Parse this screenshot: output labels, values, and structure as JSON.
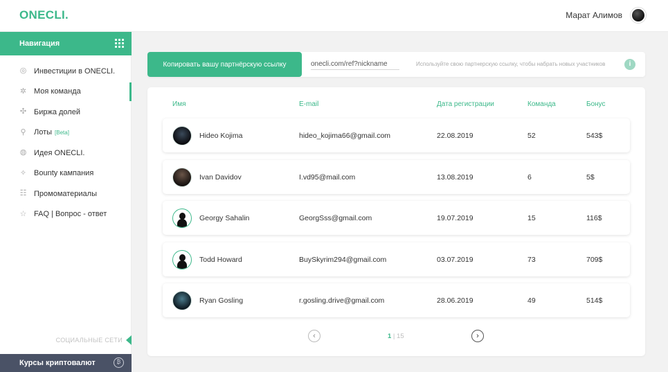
{
  "header": {
    "logo": "ONECLI.",
    "user_name": "Марат Алимов"
  },
  "sidebar": {
    "nav_title": "Навигация",
    "items": [
      {
        "label": "Инвестиции в ONECLI.",
        "icon": "invest-icon",
        "active": false
      },
      {
        "label": "Моя команда",
        "icon": "team-icon",
        "active": true
      },
      {
        "label": "Биржа долей",
        "icon": "exchange-icon",
        "active": false
      },
      {
        "label": "Лоты",
        "badge": "[Beta]",
        "icon": "lots-icon",
        "active": false
      },
      {
        "label": "Идея ONECLI.",
        "icon": "idea-icon",
        "active": false
      },
      {
        "label": "Bounty кампания",
        "icon": "bounty-icon",
        "active": false
      },
      {
        "label": "Промоматериалы",
        "icon": "promo-icon",
        "active": false
      },
      {
        "label": "FAQ | Вопрос - ответ",
        "icon": "faq-icon",
        "active": false
      }
    ],
    "social_label": "СОЦИАЛЬНЫЕ СЕТИ",
    "crypto_label": "Курсы криптовалют"
  },
  "referral": {
    "copy_button": "Копировать вашу партнёрскую ссылку",
    "link_value": "onecli.com/ref?nickname",
    "hint": "Используйте свою партнерскую ссылку, чтобы нaбрать новых участников"
  },
  "team": {
    "columns": [
      "Имя",
      "E-mail",
      "Дата регистрации",
      "Команда",
      "Бонус"
    ],
    "rows": [
      {
        "name": "Hideo Kojima",
        "email": "hideo_kojima66@gmail.com",
        "date": "22.08.2019",
        "team": "52",
        "bonus": "543$"
      },
      {
        "name": "Ivan Davidov",
        "email": "I.vd95@mail.com",
        "date": "13.08.2019",
        "team": "6",
        "bonus": "5$"
      },
      {
        "name": "Georgy Sahalin",
        "email": "GeorgSss@gmail.com",
        "date": "19.07.2019",
        "team": "15",
        "bonus": "116$"
      },
      {
        "name": "Todd Howard",
        "email": "BuySkyrim294@gmail.com",
        "date": "03.07.2019",
        "team": "73",
        "bonus": "709$"
      },
      {
        "name": "Ryan Gosling",
        "email": "r.gosling.drive@gmail.com",
        "date": "28.06.2019",
        "team": "49",
        "bonus": "514$"
      }
    ]
  },
  "pagination": {
    "current": "1",
    "separator": " | ",
    "total": "15"
  },
  "colors": {
    "accent": "#3cb88a",
    "dark_panel": "#4a5266"
  }
}
